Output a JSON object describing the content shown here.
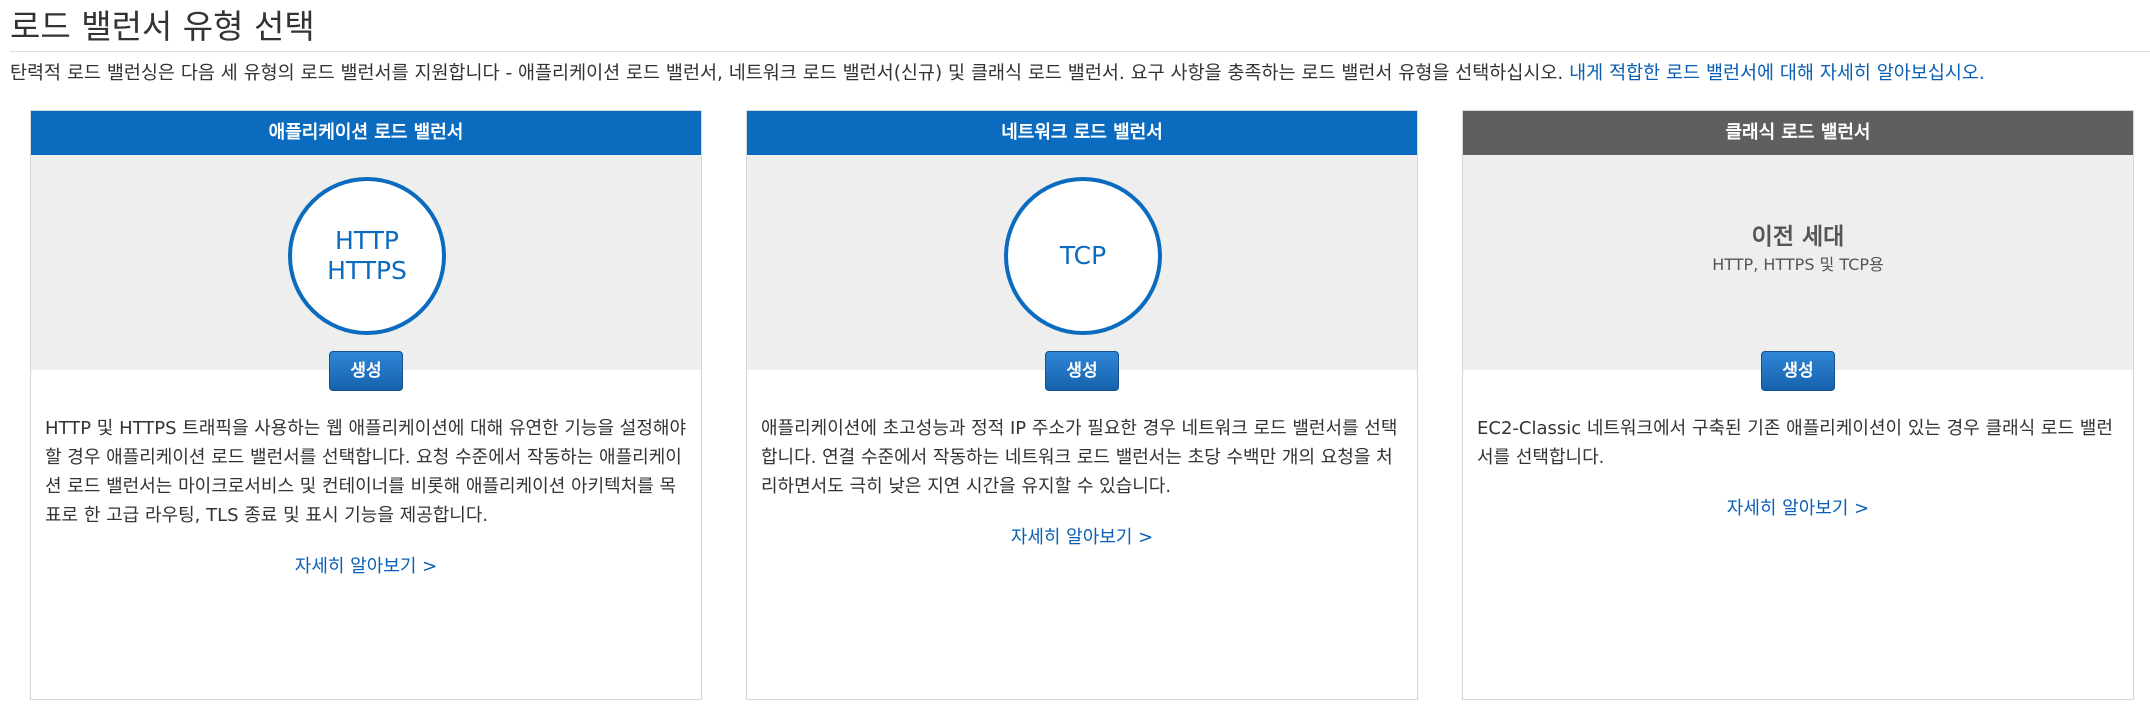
{
  "page": {
    "title": "로드 밸런서 유형 선택",
    "intro_text": "탄력적 로드 밸런싱은 다음 세 유형의 로드 밸런서를 지원합니다 - 애플리케이션 로드 밸런서, 네트워크 로드 밸런서(신규) 및 클래식 로드 밸런서. 요구 사항을 충족하는 로드 밸런서 유형을 선택하십시오.",
    "intro_link": "내게 적합한 로드 밸런서에 대해 자세히 알아보십시오."
  },
  "colors": {
    "accent_blue": "#0b6bbf",
    "header_gray": "#5f5f5f",
    "link": "#0a5eb5",
    "visual_bg": "#eeeeee"
  },
  "cards": [
    {
      "header": "애플리케이션 로드 밸런서",
      "protocol_line1": "HTTP",
      "protocol_line2": "HTTPS",
      "button": "생성",
      "description": "HTTP 및 HTTPS 트래픽을 사용하는 웹 애플리케이션에 대해 유연한 기능을 설정해야 할 경우 애플리케이션 로드 밸런서를 선택합니다. 요청 수준에서 작동하는 애플리케이션 로드 밸런서는 마이크로서비스 및 컨테이너를 비롯해 애플리케이션 아키텍처를 목표로 한 고급 라우팅, TLS 종료 및 표시 기능을 제공합니다.",
      "learn_more": "자세히 알아보기 >"
    },
    {
      "header": "네트워크 로드 밸런서",
      "protocol_line1": "TCP",
      "button": "생성",
      "description": "애플리케이션에 초고성능과 정적 IP 주소가 필요한 경우 네트워크 로드 밸런서를 선택합니다. 연결 수준에서 작동하는 네트워크 로드 밸런서는 초당 수백만 개의 요청을 처리하면서도 극히 낮은 지연 시간을 유지할 수 있습니다.",
      "learn_more": "자세히 알아보기 >"
    },
    {
      "header": "클래식 로드 밸런서",
      "legacy_title": "이전 세대",
      "legacy_subtitle": "HTTP, HTTPS 및 TCP용",
      "button": "생성",
      "description": "EC2-Classic 네트워크에서 구축된 기존 애플리케이션이 있는 경우 클래식 로드 밸런서를 선택합니다.",
      "learn_more": "자세히 알아보기 >"
    }
  ]
}
